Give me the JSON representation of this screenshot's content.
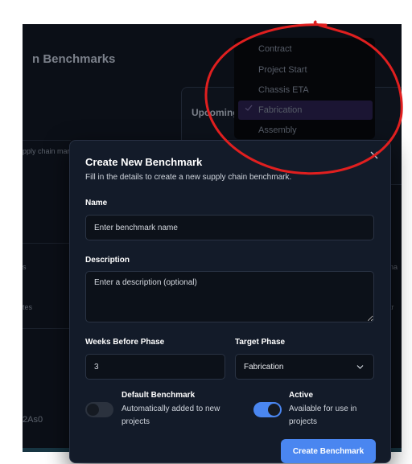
{
  "background": {
    "page_title": "n Benchmarks",
    "card_label": "Upcoming",
    "left_snippets": [
      "pply chain mar",
      "s",
      "tes",
      "2As0"
    ],
    "right_snippets": [
      "na",
      "tr"
    ]
  },
  "dropdown": {
    "options": [
      {
        "label": "Contract"
      },
      {
        "label": "Project Start"
      },
      {
        "label": "Chassis ETA"
      },
      {
        "label": "Fabrication",
        "selected": true
      },
      {
        "label": "Assembly"
      }
    ]
  },
  "modal": {
    "title": "Create New Benchmark",
    "subtitle": "Fill in the details to create a new supply chain benchmark.",
    "name": {
      "label": "Name",
      "placeholder": "Enter benchmark name",
      "value": ""
    },
    "description": {
      "label": "Description",
      "placeholder": "Enter a description (optional)",
      "value": ""
    },
    "weeks": {
      "label": "Weeks Before Phase",
      "value": "3"
    },
    "target_phase": {
      "label": "Target Phase",
      "value": "Fabrication"
    },
    "default_toggle": {
      "title": "Default Benchmark",
      "description": "Automatically added to new projects",
      "enabled": false
    },
    "active_toggle": {
      "title": "Active",
      "description": "Available for use in projects",
      "enabled": true
    },
    "submit_label": "Create Benchmark"
  },
  "colors": {
    "accent": "#4a86f0",
    "modal_bg": "#131b29",
    "annotation": "#e01f1f",
    "selected_option_bg": "#1b1533"
  }
}
